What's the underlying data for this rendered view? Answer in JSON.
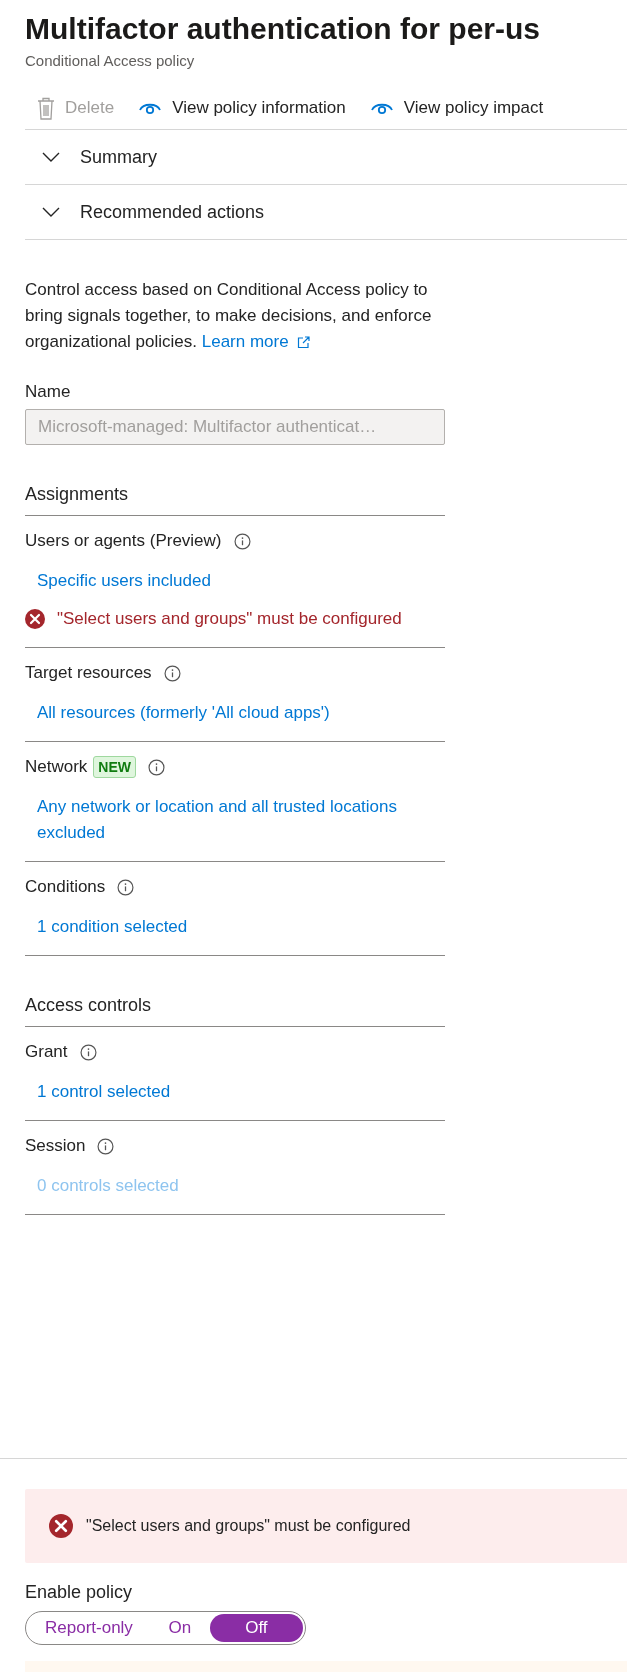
{
  "header": {
    "title": "Multifactor authentication for per-us",
    "subtitle": "Conditional Access policy"
  },
  "toolbar": [
    {
      "kind": "delete",
      "label": "Delete",
      "disabled": true
    },
    {
      "kind": "view",
      "label": "View policy information",
      "disabled": false
    },
    {
      "kind": "view",
      "label": "View policy impact",
      "disabled": false
    }
  ],
  "accordions": [
    {
      "label": "Summary",
      "expanded": false
    },
    {
      "label": "Recommended actions",
      "expanded": false
    }
  ],
  "description": "Control access based on Conditional Access policy to bring signals together, to make decisions, and enforce organizational policies.",
  "learn_more": "Learn more",
  "name_field": {
    "label": "Name",
    "value": "Microsoft-managed: Multifactor authenticat…",
    "disabled": true
  },
  "sections": [
    {
      "title": "Assignments",
      "items": [
        {
          "label": "Users or agents (Preview)",
          "link": "Specific users included",
          "link_disabled": false,
          "error": "\"Select users and groups\" must be configured"
        },
        {
          "label": "Target resources",
          "link": "All resources (formerly 'All cloud apps')",
          "link_disabled": false
        },
        {
          "label": "Network",
          "badge": "NEW",
          "link": "Any network or location and all trusted locations excluded",
          "link_disabled": false
        },
        {
          "label": "Conditions",
          "link": "1 condition selected",
          "link_disabled": false
        }
      ]
    },
    {
      "title": "Access controls",
      "items": [
        {
          "label": "Grant",
          "link": "1 control selected",
          "link_disabled": false
        },
        {
          "label": "Session",
          "link": "0 controls selected",
          "link_disabled": true
        }
      ]
    }
  ],
  "error_banner": {
    "message": "\"Select users and groups\" must be configured"
  },
  "enable_policy": {
    "label": "Enable policy",
    "options": [
      {
        "label": "Report-only",
        "selected": false
      },
      {
        "label": "On",
        "selected": false
      },
      {
        "label": "Off",
        "selected": true
      }
    ]
  }
}
